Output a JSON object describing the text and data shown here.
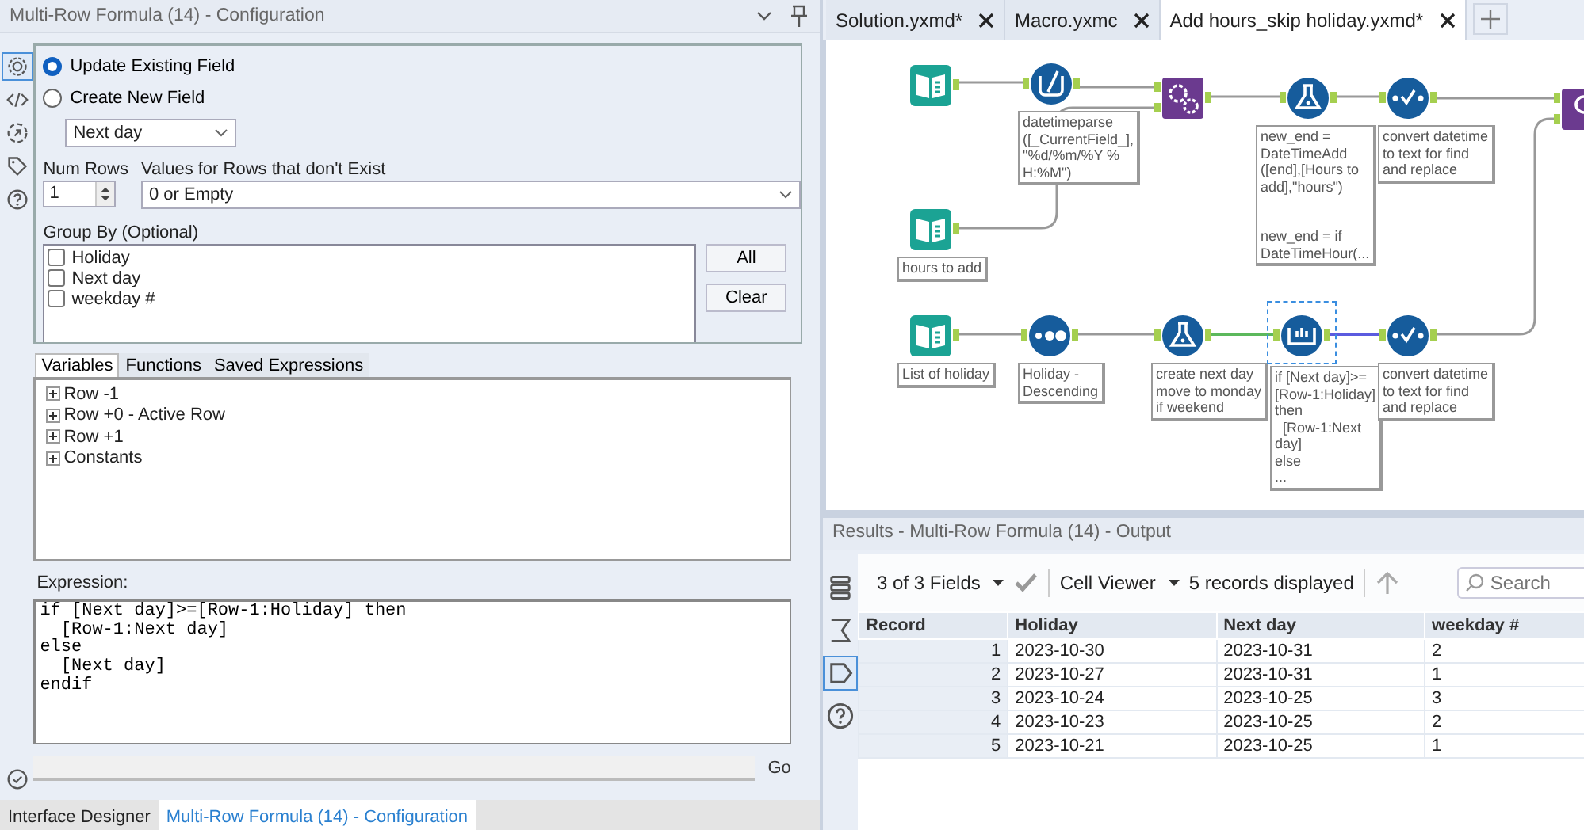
{
  "config_panel": {
    "title": "Multi-Row Formula (14) - Configuration",
    "rail": [
      {
        "kind": "settings",
        "selected": true
      },
      {
        "kind": "code",
        "selected": false
      },
      {
        "kind": "annotation",
        "selected": false
      },
      {
        "kind": "tag",
        "selected": false
      },
      {
        "kind": "help",
        "selected": false
      }
    ],
    "radios": [
      {
        "label": "Update Existing Field",
        "selected": true
      },
      {
        "label": "Create New  Field",
        "selected": false
      }
    ],
    "field_dropdown": {
      "value": "Next day"
    },
    "num_rows": {
      "label": "Num Rows",
      "value": "1"
    },
    "missing_rows": {
      "label": "Values for Rows that don't Exist",
      "value": "0 or Empty"
    },
    "group_by": {
      "label": "Group By (Optional)",
      "items": [
        {
          "label": "Holiday",
          "checked": false
        },
        {
          "label": "Next day",
          "checked": false
        },
        {
          "label": "weekday #",
          "checked": false
        }
      ],
      "buttons": [
        "All",
        "Clear"
      ]
    },
    "tabs": [
      {
        "label": "Variables",
        "selected": true
      },
      {
        "label": "Functions",
        "selected": false
      },
      {
        "label": "Saved Expressions",
        "selected": false
      }
    ],
    "tree": [
      {
        "label": "Row -1",
        "expanded": false
      },
      {
        "label": "Row +0 - Active Row",
        "expanded": false
      },
      {
        "label": "Row +1",
        "expanded": false
      },
      {
        "label": "Constants",
        "expanded": false
      }
    ],
    "expression": {
      "label": "Expression:",
      "value": "if [Next day]>=[Row-1:Holiday] then\n  [Row-1:Next day]\nelse\n  [Next day]\nendif"
    },
    "go": "Go"
  },
  "bottom_tabs": [
    {
      "label": "Interface Designer",
      "selected": false
    },
    {
      "label": "Multi-Row Formula (14) - Configuration",
      "selected": true
    }
  ],
  "workflow_tabs": [
    {
      "label": "Solution.yxmd*",
      "selected": false
    },
    {
      "label": "Macro.yxmc",
      "selected": false
    },
    {
      "label": "Add hours_skip holiday.yxmd*",
      "selected": true
    }
  ],
  "canvas": {
    "nodes": [
      {
        "kind": "input",
        "selected": false
      },
      {
        "kind": "parse",
        "selected": false,
        "annotation": "datetimeparse\n([_CurrentField_],\n\"%d/%m/%Y %\nH:%M\")"
      },
      {
        "kind": "macro",
        "selected": false
      },
      {
        "kind": "formula",
        "selected": false,
        "annotation": "new_end =\nDateTimeAdd\n([end],[Hours to\nadd],\"hours\")\n\n\nnew_end = if\nDateTimeHour(..."
      },
      {
        "kind": "select",
        "selected": false,
        "annotation": "convert datetime\nto text for find\nand replace"
      },
      {
        "kind": "join",
        "selected": false
      },
      {
        "kind": "input",
        "selected": false,
        "annotation": "hours to add"
      },
      {
        "kind": "input",
        "selected": false,
        "annotation": "List of holiday"
      },
      {
        "kind": "sort",
        "selected": false,
        "annotation": "Holiday -\nDescending"
      },
      {
        "kind": "formula",
        "selected": false,
        "annotation": "create next day\nmove to monday\nif weekend"
      },
      {
        "kind": "multirow",
        "selected": true,
        "annotation": "if [Next day]>=\n[Row-1:Holiday]\nthen\n  [Row-1:Next\nday]\nelse\n..."
      },
      {
        "kind": "select",
        "selected": false,
        "annotation": "convert datetime\nto text for find\nand replace"
      }
    ]
  },
  "results": {
    "title": "Results - Multi-Row Formula (14) - Output",
    "rail": [
      {
        "kind": "rows",
        "selected": false
      },
      {
        "kind": "sigma",
        "selected": false
      },
      {
        "kind": "tag",
        "selected": true
      },
      {
        "kind": "help",
        "selected": false
      }
    ],
    "fields": "3 of 3 Fields",
    "viewer": "Cell Viewer",
    "count": "5 records displayed",
    "search": {
      "placeholder": "Search"
    },
    "table": {
      "columns": [
        "Record",
        "Holiday",
        "Next day",
        "weekday #"
      ],
      "rows": [
        [
          "1",
          "2023-10-30",
          "2023-10-31",
          "2"
        ],
        [
          "2",
          "2023-10-27",
          "2023-10-31",
          "1"
        ],
        [
          "3",
          "2023-10-24",
          "2023-10-25",
          "3"
        ],
        [
          "4",
          "2023-10-23",
          "2023-10-25",
          "2"
        ],
        [
          "5",
          "2023-10-21",
          "2023-10-25",
          "1"
        ]
      ]
    }
  }
}
